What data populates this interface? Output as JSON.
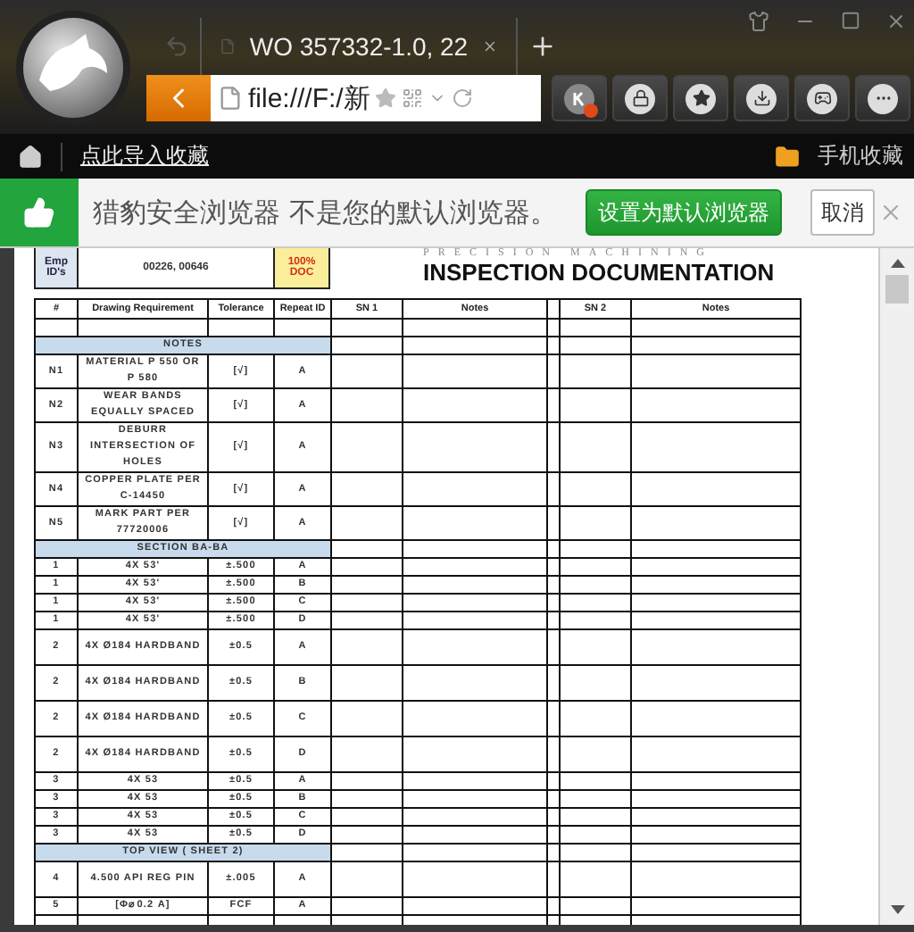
{
  "browser": {
    "tab_title": "WO 357332-1.0, 22",
    "address": "file:///F:/新"
  },
  "bookmarks_bar": {
    "import_link": "点此导入收藏",
    "mobile_bookmarks": "手机收藏"
  },
  "notification": {
    "message": "猎豹安全浏览器 不是您的默认浏览器。",
    "primary_button": "设置为默认浏览器",
    "cancel_button": "取消"
  },
  "document": {
    "brand": "PRECISION MACHINING",
    "title": "INSPECTION DOCUMENTATION",
    "emp_label": "Emp ID's",
    "emp_ids": "00226, 00646",
    "doc_badge": "100% DOC",
    "table": {
      "columns": [
        "#",
        "Drawing Requirement",
        "Tolerance",
        "Repeat ID",
        "SN 1",
        "Notes",
        "SN 2",
        "Notes"
      ],
      "rows": [
        {
          "kind": "blank"
        },
        {
          "kind": "section",
          "title": "NOTES"
        },
        {
          "kind": "item",
          "num": "N1",
          "requirement": "MATERIAL P 550 OR P 580",
          "tolerance": "[√]",
          "repeat_id": "A"
        },
        {
          "kind": "item",
          "num": "N2",
          "requirement": "WEAR BANDS EQUALLY SPACED",
          "tolerance": "[√]",
          "repeat_id": "A"
        },
        {
          "kind": "item",
          "num": "N3",
          "requirement": "DEBURR INTERSECTION OF HOLES",
          "tolerance": "[√]",
          "repeat_id": "A"
        },
        {
          "kind": "item",
          "num": "N4",
          "requirement": "COPPER PLATE PER C-14450",
          "tolerance": "[√]",
          "repeat_id": "A"
        },
        {
          "kind": "item",
          "num": "N5",
          "requirement": "MARK PART PER 77720006",
          "tolerance": "[√]",
          "repeat_id": "A"
        },
        {
          "kind": "section",
          "title": "SECTION BA-BA"
        },
        {
          "kind": "item",
          "num": "1",
          "requirement": "4X 53'",
          "tolerance": "±.500",
          "repeat_id": "A"
        },
        {
          "kind": "item",
          "num": "1",
          "requirement": "4X 53'",
          "tolerance": "±.500",
          "repeat_id": "B"
        },
        {
          "kind": "item",
          "num": "1",
          "requirement": "4X 53'",
          "tolerance": "±.500",
          "repeat_id": "C"
        },
        {
          "kind": "item",
          "num": "1",
          "requirement": "4X 53'",
          "tolerance": "±.500",
          "repeat_id": "D"
        },
        {
          "kind": "tall",
          "num": "2",
          "requirement": "4X Ø184 HARDBAND",
          "tolerance": "±0.5",
          "repeat_id": "A"
        },
        {
          "kind": "tall",
          "num": "2",
          "requirement": "4X Ø184 HARDBAND",
          "tolerance": "±0.5",
          "repeat_id": "B"
        },
        {
          "kind": "tall",
          "num": "2",
          "requirement": "4X Ø184 HARDBAND",
          "tolerance": "±0.5",
          "repeat_id": "C"
        },
        {
          "kind": "tall",
          "num": "2",
          "requirement": "4X Ø184 HARDBAND",
          "tolerance": "±0.5",
          "repeat_id": "D"
        },
        {
          "kind": "item",
          "num": "3",
          "requirement": "4X 53",
          "tolerance": "±0.5",
          "repeat_id": "A"
        },
        {
          "kind": "item",
          "num": "3",
          "requirement": "4X 53",
          "tolerance": "±0.5",
          "repeat_id": "B"
        },
        {
          "kind": "item",
          "num": "3",
          "requirement": "4X 53",
          "tolerance": "±0.5",
          "repeat_id": "C"
        },
        {
          "kind": "item",
          "num": "3",
          "requirement": "4X 53",
          "tolerance": "±0.5",
          "repeat_id": "D"
        },
        {
          "kind": "section",
          "title": "TOP VIEW ( SHEET 2)"
        },
        {
          "kind": "tall",
          "num": "4",
          "requirement": "4.500 API REG PIN",
          "tolerance": "±.005",
          "repeat_id": "A"
        },
        {
          "kind": "item",
          "num": "5",
          "requirement": "[Φ⌀0.2 A]",
          "tolerance": "FCF",
          "repeat_id": "A"
        },
        {
          "kind": "blank"
        }
      ]
    }
  }
}
